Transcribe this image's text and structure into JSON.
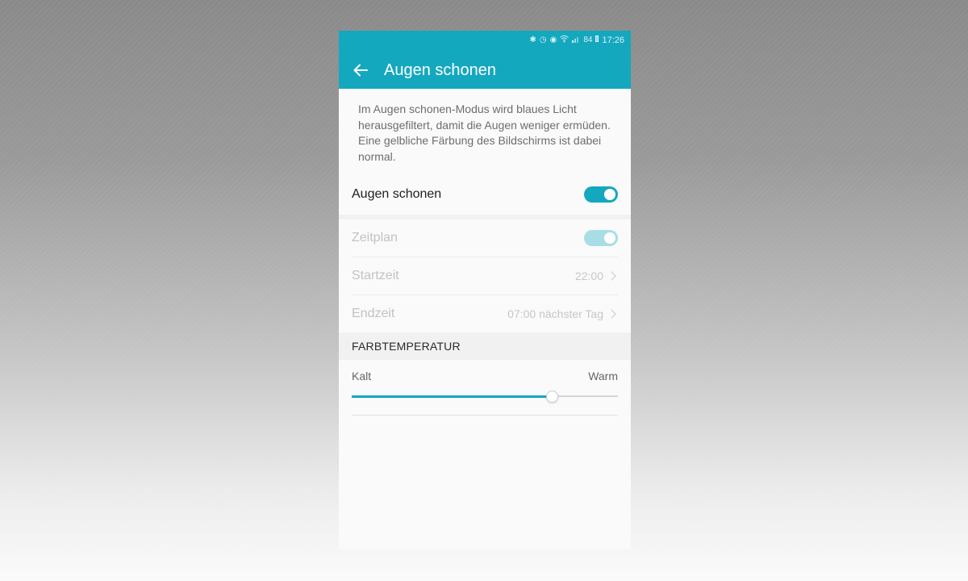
{
  "status_bar": {
    "icons": [
      "bluetooth-icon",
      "alarm-icon",
      "eye-icon",
      "wifi-icon",
      "signal-icon"
    ],
    "battery": "84",
    "time": "17:26"
  },
  "app_bar": {
    "title": "Augen schonen",
    "color": "#14a8bf"
  },
  "description": {
    "line1": "Im Augen schonen-Modus wird blaues Licht herausgefiltert, damit die Augen weniger ermüden.",
    "line2": "Eine gelbliche Färbung des Bildschirms ist dabei normal."
  },
  "main_toggle": {
    "label": "Augen schonen",
    "on": true
  },
  "schedule": {
    "label": "Zeitplan",
    "on": true,
    "enabled": false
  },
  "start_time": {
    "label": "Startzeit",
    "value": "22:00"
  },
  "end_time": {
    "label": "Endzeit",
    "value": "07:00 nächster Tag"
  },
  "color_temperature": {
    "header": "FARBTEMPERATUR",
    "min_label": "Kalt",
    "max_label": "Warm",
    "level": 0.75
  }
}
